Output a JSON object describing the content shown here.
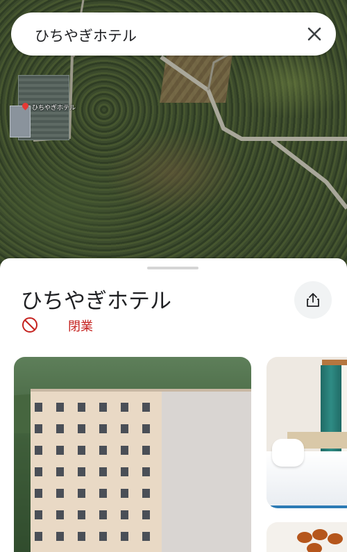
{
  "search": {
    "query": "ひちやぎホテル",
    "close_icon": "close-icon"
  },
  "map": {
    "pin_label": "ひちやぎホテル",
    "pin_icon": "map-pin-icon",
    "pin_color": "#e53935"
  },
  "place": {
    "title": "ひちやぎホテル",
    "status": "閉業",
    "status_icon": "no-entry-icon",
    "status_color": "#c5221f",
    "share_icon": "share-icon"
  },
  "photos": [
    "hotel-exterior",
    "hotel-room",
    "hotel-food"
  ]
}
